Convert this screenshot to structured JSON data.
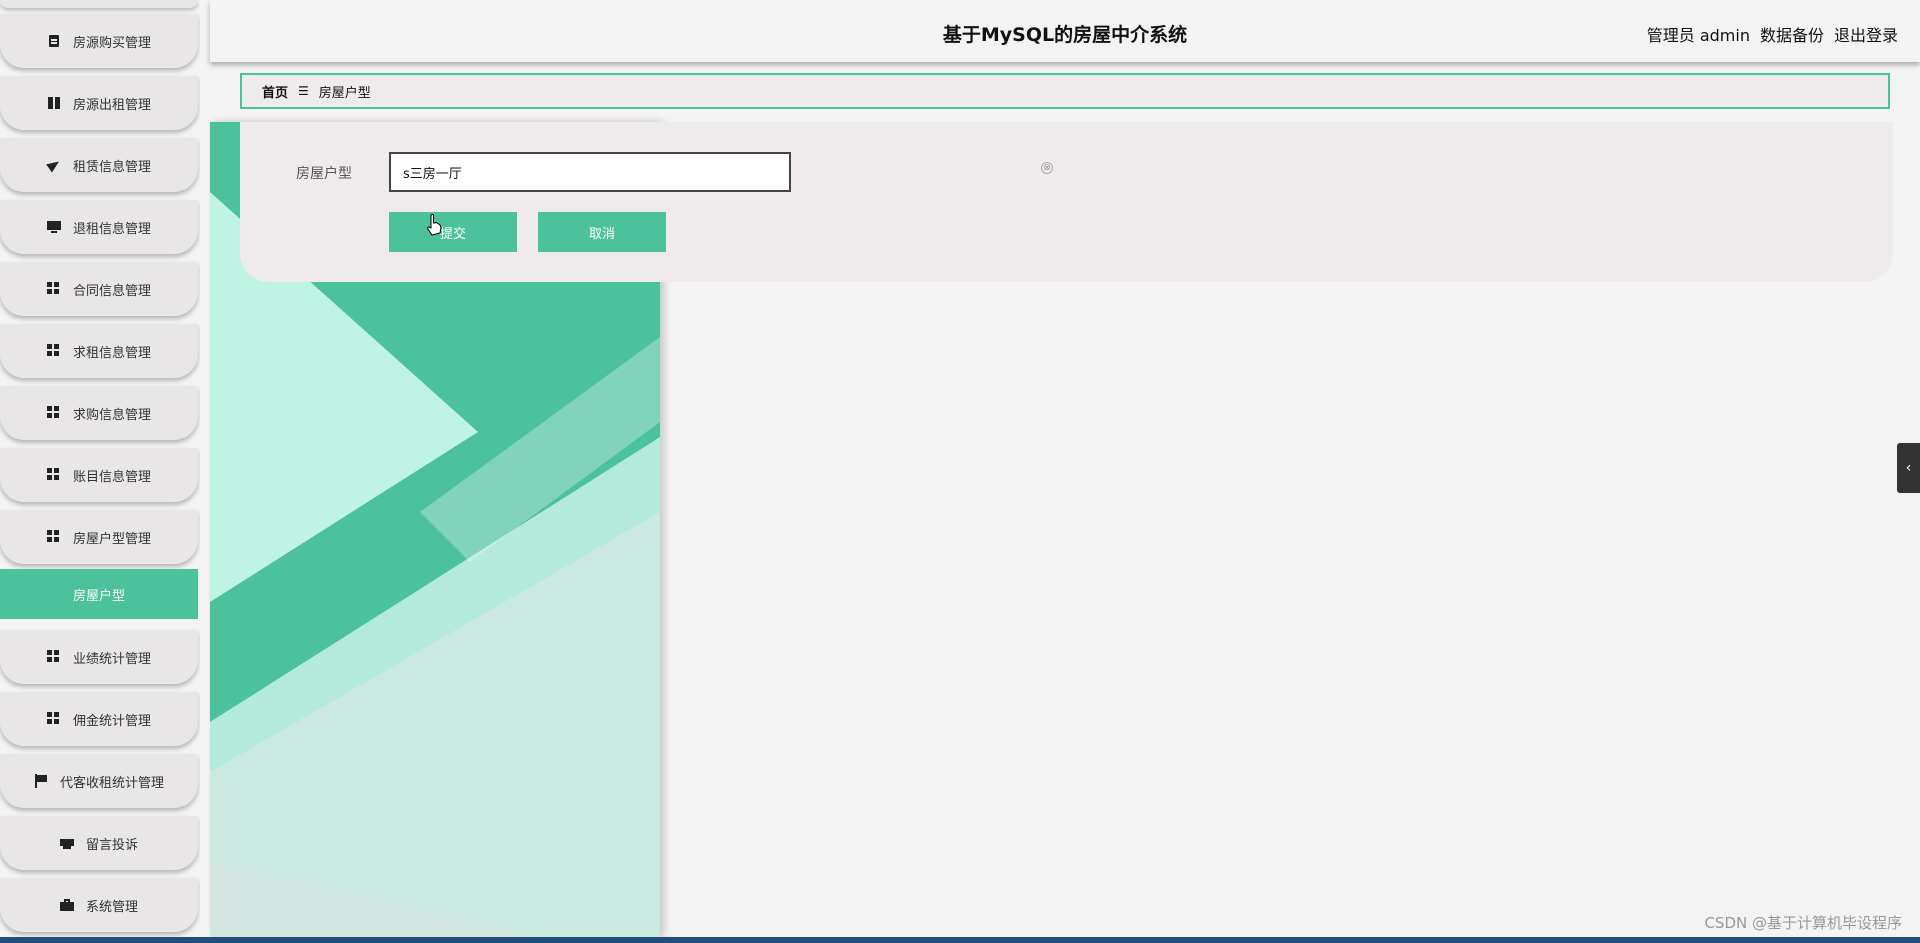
{
  "header": {
    "title": "基于MySQL的房屋中介系统",
    "user": "管理员 admin",
    "backup": "数据备份",
    "logout": "退出登录"
  },
  "sidebar": {
    "items": [
      {
        "label": "房源购买管理",
        "icon": "clipboard-icon"
      },
      {
        "label": "房源出租管理",
        "icon": "book-icon"
      },
      {
        "label": "租赁信息管理",
        "icon": "paper-plane-icon"
      },
      {
        "label": "退租信息管理",
        "icon": "monitor-icon"
      },
      {
        "label": "合同信息管理",
        "icon": "grid-icon"
      },
      {
        "label": "求租信息管理",
        "icon": "grid-icon"
      },
      {
        "label": "求购信息管理",
        "icon": "grid-icon"
      },
      {
        "label": "账目信息管理",
        "icon": "grid-icon"
      },
      {
        "label": "房屋户型管理",
        "icon": "grid-icon"
      },
      {
        "label": "房屋户型",
        "icon": ""
      },
      {
        "label": "业绩统计管理",
        "icon": "grid-icon"
      },
      {
        "label": "佣金统计管理",
        "icon": "grid-icon"
      },
      {
        "label": "代客收租统计管理",
        "icon": "flag-icon"
      },
      {
        "label": "留言投诉",
        "icon": "printer-icon"
      },
      {
        "label": "系统管理",
        "icon": "suitcase-icon"
      }
    ]
  },
  "breadcrumb": {
    "home": "首页",
    "separator": "☰",
    "current": "房屋户型"
  },
  "form": {
    "label": "房屋户型",
    "value": "s三房一厅",
    "clear_icon": "⊗",
    "submit": "提交",
    "cancel": "取消"
  },
  "watermark": "CSDN @基于计算机毕设程序",
  "colors": {
    "accent": "#4bc29b",
    "art_light": "#b9efdf"
  }
}
